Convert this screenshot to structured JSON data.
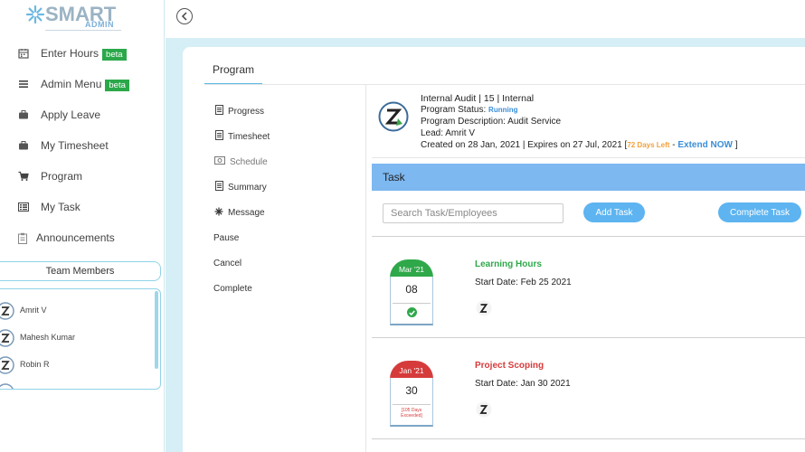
{
  "brand": {
    "name": "SMART",
    "sub": "ADMIN"
  },
  "sidebar": {
    "items": [
      {
        "label": "Enter Hours",
        "icon": "calendar-icon",
        "badge": "beta"
      },
      {
        "label": "Admin Menu",
        "icon": "hamburger-icon",
        "badge": "beta"
      },
      {
        "label": "Apply Leave",
        "icon": "briefcase-icon"
      },
      {
        "label": "My Timesheet",
        "icon": "briefcase-icon"
      },
      {
        "label": "Program",
        "icon": "cart-icon"
      },
      {
        "label": "My Task",
        "icon": "tasklist-icon"
      },
      {
        "label": "Announcements",
        "icon": "clipboard-icon"
      }
    ],
    "team_header": "Team Members",
    "members": [
      "Amrit V",
      "Mahesh Kumar",
      "Robin R"
    ]
  },
  "tabs": {
    "program": "Program"
  },
  "program_menu": {
    "progress": "Progress",
    "timesheet": "Timesheet",
    "schedule": "Schedule",
    "summary": "Summary",
    "message": "Message",
    "pause": "Pause",
    "cancel": "Cancel",
    "complete": "Complete"
  },
  "program": {
    "title": "Internal Audit | 15 | Internal",
    "status_label": "Program Status:",
    "status_value": "Running",
    "description": "Program Description: Audit Service",
    "lead": "Lead: Amrit V",
    "created_text": "Created on 28 Jan, 2021 | Expires on 27 Jul, 2021 [",
    "days_left": "72 Days Left",
    "dash": "-",
    "extend": "Extend NOW",
    "close_bracket": "]"
  },
  "task_section": {
    "title": "Task",
    "search_placeholder": "Search Task/Employees",
    "add_label": "Add Task",
    "complete_label": "Complete Task"
  },
  "tasks": [
    {
      "month": "Mar '21",
      "day": "08",
      "name": "Learning Hours",
      "start": "Start Date: Feb 25 2021",
      "color": "#2fa84a"
    },
    {
      "month": "Jan '21",
      "day": "30",
      "name": "Project Scoping",
      "start": "Start Date: Jan 30 2021",
      "note": "[105 Days Exceeded]",
      "color": "#d63b3b"
    }
  ],
  "colors": {
    "accent": "#5db4f0",
    "task_bar": "#7db8f0",
    "beta": "#2ba84a",
    "content_bg": "#d6eef6"
  }
}
